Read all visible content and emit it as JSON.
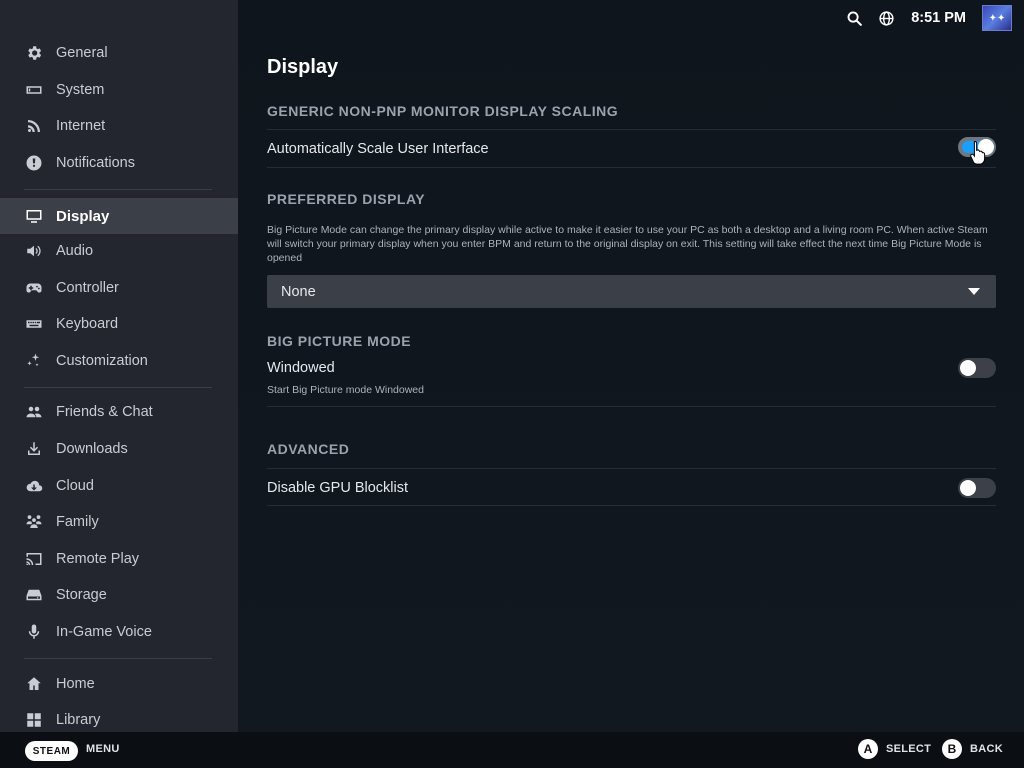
{
  "sidebar": {
    "items": [
      {
        "label": "General",
        "icon": "gear-icon"
      },
      {
        "label": "System",
        "icon": "system-icon"
      },
      {
        "label": "Internet",
        "icon": "wifi-icon"
      },
      {
        "label": "Notifications",
        "icon": "alert-icon"
      },
      {
        "label": "Display",
        "icon": "monitor-icon",
        "active": true
      },
      {
        "label": "Audio",
        "icon": "speaker-icon"
      },
      {
        "label": "Controller",
        "icon": "gamepad-icon"
      },
      {
        "label": "Keyboard",
        "icon": "keyboard-icon"
      },
      {
        "label": "Customization",
        "icon": "sparkle-icon"
      },
      {
        "label": "Friends & Chat",
        "icon": "friends-icon"
      },
      {
        "label": "Downloads",
        "icon": "download-icon"
      },
      {
        "label": "Cloud",
        "icon": "cloud-icon"
      },
      {
        "label": "Family",
        "icon": "family-icon"
      },
      {
        "label": "Remote Play",
        "icon": "cast-icon"
      },
      {
        "label": "Storage",
        "icon": "storage-icon"
      },
      {
        "label": "In-Game Voice",
        "icon": "microphone-icon"
      },
      {
        "label": "Home",
        "icon": "home-icon"
      },
      {
        "label": "Library",
        "icon": "grid-icon"
      }
    ]
  },
  "topbar": {
    "time": "8:51 PM",
    "avatar_text": "✦✦"
  },
  "main": {
    "title": "Display",
    "sections": {
      "scaling": {
        "title": "GENERIC NON-PNP MONITOR DISPLAY SCALING",
        "auto_scale_label": "Automatically Scale User Interface",
        "auto_scale_on": true
      },
      "preferred": {
        "title": "PREFERRED DISPLAY",
        "description": "Big Picture Mode can change the primary display while active to make it easier to use your PC as both a desktop and a living room PC. When active Steam will switch your primary display when you enter BPM and return to the original display on exit. This setting will take effect the next time Big Picture Mode is opened",
        "selected": "None"
      },
      "bpm": {
        "title": "BIG PICTURE MODE",
        "windowed_label": "Windowed",
        "windowed_desc": "Start Big Picture mode Windowed",
        "windowed_on": false
      },
      "advanced": {
        "title": "ADVANCED",
        "gpu_label": "Disable GPU Blocklist",
        "gpu_on": false
      }
    }
  },
  "footer": {
    "steam": "STEAM",
    "menu": "MENU",
    "a_button": "A",
    "select": "SELECT",
    "b_button": "B",
    "back": "BACK"
  },
  "colors": {
    "accent": "#1a9fff",
    "sidebar_bg": "#23262e",
    "active_bg": "#3a3f48",
    "main_bg": "#0f151c"
  }
}
